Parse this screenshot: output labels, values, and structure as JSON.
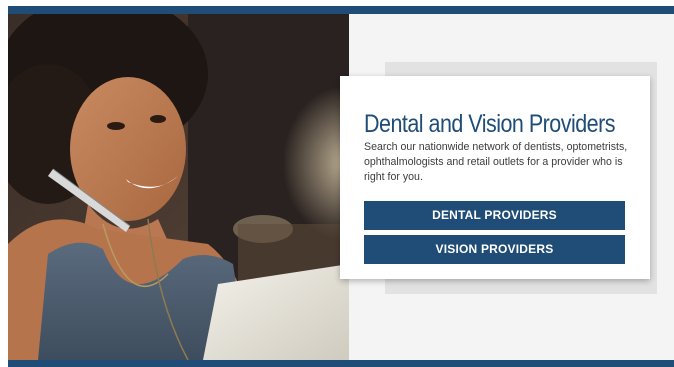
{
  "banner": {
    "title": "Dental and Vision Providers",
    "description": "Search our nationwide network of dentists, optometrists, ophthalmologists and retail outlets for a provider who is right for you.",
    "dental_button_label": "DENTAL PROVIDERS",
    "vision_button_label": "VISION PROVIDERS"
  },
  "colors": {
    "brand_blue": "#1f4d78",
    "card_background": "#ffffff",
    "page_background": "#f4f4f4"
  }
}
